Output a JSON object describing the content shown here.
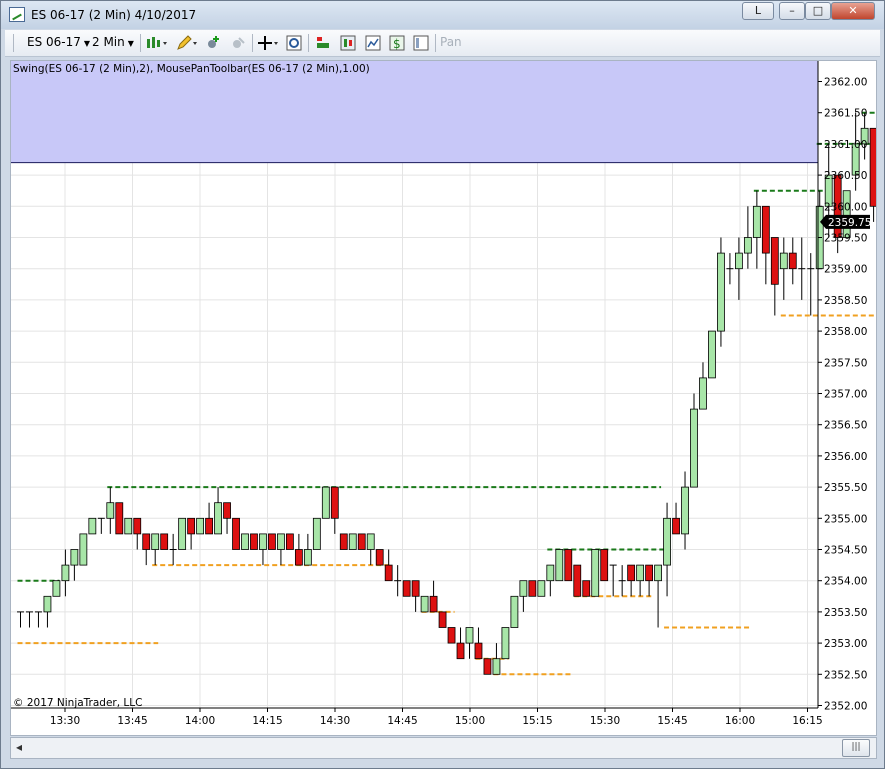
{
  "window": {
    "title": "ES 06-17 (2 Min)  4/10/2017",
    "btn_l": "L",
    "btn_min": "–",
    "btn_max": "□",
    "btn_close": "✕"
  },
  "toolbar": {
    "instrument": "ES 06-17",
    "interval": "2 Min",
    "pan_label": "Pan"
  },
  "chart": {
    "indicator_label": "Swing(ES 06-17 (2 Min),2), MousePanToolbar(ES 06-17 (2 Min),1.00)",
    "copyright": "© 2017 NinjaTrader, LLC",
    "last_price": "2359.75",
    "colors": {
      "up": "#a8e6a8",
      "down": "#dd1111",
      "swing_high": "#1a7a1a",
      "swing_low": "#f0a020",
      "zone": "#c8c8f8"
    }
  },
  "chart_data": {
    "type": "candlestick",
    "instrument": "ES 06-17",
    "interval": "2 Min",
    "date": "4/10/2017",
    "ylim": [
      2352.0,
      2362.0
    ],
    "y_ticks": [
      "2362.00",
      "2361.50",
      "2361.00",
      "2360.50",
      "2360.00",
      "2359.50",
      "2359.00",
      "2358.50",
      "2358.00",
      "2357.50",
      "2357.00",
      "2356.50",
      "2356.00",
      "2355.50",
      "2355.00",
      "2354.50",
      "2354.00",
      "2353.50",
      "2353.00",
      "2352.50",
      "2352.00"
    ],
    "x_ticks": [
      "13:30",
      "13:45",
      "14:00",
      "14:15",
      "14:30",
      "14:45",
      "15:00",
      "15:15",
      "15:30",
      "15:45",
      "16:00",
      "16:15"
    ],
    "candles": [
      [
        2353.5,
        2353.5,
        2353.25,
        2353.5
      ],
      [
        2353.5,
        2353.5,
        2353.25,
        2353.5
      ],
      [
        2353.5,
        2353.5,
        2353.25,
        2353.5
      ],
      [
        2353.5,
        2353.75,
        2353.25,
        2353.75
      ],
      [
        2353.75,
        2354.0,
        2353.75,
        2354.0
      ],
      [
        2354.0,
        2354.5,
        2353.75,
        2354.25
      ],
      [
        2354.25,
        2354.5,
        2354.0,
        2354.5
      ],
      [
        2354.25,
        2354.75,
        2354.25,
        2354.75
      ],
      [
        2354.75,
        2355.0,
        2354.75,
        2355.0
      ],
      [
        2355.0,
        2355.0,
        2354.75,
        2355.0
      ],
      [
        2355.0,
        2355.5,
        2354.75,
        2355.25
      ],
      [
        2355.25,
        2355.25,
        2354.75,
        2354.75
      ],
      [
        2354.75,
        2355.0,
        2354.75,
        2355.0
      ],
      [
        2355.0,
        2355.0,
        2354.5,
        2354.75
      ],
      [
        2354.75,
        2354.75,
        2354.25,
        2354.5
      ],
      [
        2354.5,
        2354.75,
        2354.25,
        2354.75
      ],
      [
        2354.75,
        2354.75,
        2354.5,
        2354.5
      ],
      [
        2354.5,
        2354.75,
        2354.25,
        2354.5
      ],
      [
        2354.5,
        2355.0,
        2354.5,
        2355.0
      ],
      [
        2355.0,
        2355.0,
        2354.5,
        2354.75
      ],
      [
        2354.75,
        2355.0,
        2354.75,
        2355.0
      ],
      [
        2355.0,
        2355.25,
        2354.75,
        2354.75
      ],
      [
        2354.75,
        2355.5,
        2354.75,
        2355.25
      ],
      [
        2355.25,
        2355.25,
        2354.75,
        2355.0
      ],
      [
        2355.0,
        2355.0,
        2354.5,
        2354.5
      ],
      [
        2354.5,
        2354.75,
        2354.5,
        2354.75
      ],
      [
        2354.75,
        2354.75,
        2354.5,
        2354.5
      ],
      [
        2354.5,
        2354.75,
        2354.25,
        2354.75
      ],
      [
        2354.75,
        2354.75,
        2354.5,
        2354.5
      ],
      [
        2354.5,
        2354.75,
        2354.25,
        2354.75
      ],
      [
        2354.75,
        2354.75,
        2354.5,
        2354.5
      ],
      [
        2354.5,
        2354.75,
        2354.25,
        2354.25
      ],
      [
        2354.25,
        2354.75,
        2354.25,
        2354.5
      ],
      [
        2354.5,
        2355.0,
        2354.5,
        2355.0
      ],
      [
        2355.0,
        2355.5,
        2355.0,
        2355.5
      ],
      [
        2355.5,
        2355.5,
        2354.75,
        2355.0
      ],
      [
        2354.75,
        2354.75,
        2354.5,
        2354.5
      ],
      [
        2354.5,
        2354.75,
        2354.5,
        2354.75
      ],
      [
        2354.75,
        2354.75,
        2354.5,
        2354.5
      ],
      [
        2354.5,
        2354.75,
        2354.25,
        2354.75
      ],
      [
        2354.5,
        2354.5,
        2354.25,
        2354.25
      ],
      [
        2354.25,
        2354.5,
        2354.0,
        2354.0
      ],
      [
        2354.0,
        2354.25,
        2353.75,
        2354.0
      ],
      [
        2354.0,
        2354.0,
        2353.75,
        2353.75
      ],
      [
        2354.0,
        2354.0,
        2353.5,
        2353.75
      ],
      [
        2353.5,
        2353.75,
        2353.5,
        2353.75
      ],
      [
        2353.75,
        2354.0,
        2353.5,
        2353.5
      ],
      [
        2353.5,
        2353.5,
        2353.25,
        2353.25
      ],
      [
        2353.25,
        2353.25,
        2353.0,
        2353.0
      ],
      [
        2353.0,
        2353.25,
        2352.75,
        2352.75
      ],
      [
        2353.0,
        2353.25,
        2352.75,
        2353.25
      ],
      [
        2353.0,
        2353.25,
        2352.75,
        2352.75
      ],
      [
        2352.75,
        2352.75,
        2352.5,
        2352.5
      ],
      [
        2352.5,
        2353.0,
        2352.5,
        2352.75
      ],
      [
        2352.75,
        2353.25,
        2352.75,
        2353.25
      ],
      [
        2353.25,
        2353.75,
        2353.25,
        2353.75
      ],
      [
        2353.75,
        2354.0,
        2353.5,
        2354.0
      ],
      [
        2354.0,
        2354.0,
        2353.75,
        2353.75
      ],
      [
        2353.75,
        2354.0,
        2353.75,
        2354.0
      ],
      [
        2354.0,
        2354.25,
        2353.75,
        2354.25
      ],
      [
        2354.0,
        2354.5,
        2354.0,
        2354.5
      ],
      [
        2354.5,
        2354.5,
        2354.0,
        2354.0
      ],
      [
        2354.25,
        2354.25,
        2353.75,
        2353.75
      ],
      [
        2354.0,
        2354.0,
        2353.75,
        2353.75
      ],
      [
        2353.75,
        2354.5,
        2353.75,
        2354.5
      ],
      [
        2354.5,
        2354.5,
        2354.0,
        2354.0
      ],
      [
        2354.25,
        2354.25,
        2353.75,
        2354.25
      ],
      [
        2354.0,
        2354.25,
        2353.75,
        2354.0
      ],
      [
        2354.25,
        2354.25,
        2353.75,
        2354.0
      ],
      [
        2354.0,
        2354.25,
        2353.75,
        2354.25
      ],
      [
        2354.25,
        2354.25,
        2353.75,
        2354.0
      ],
      [
        2354.0,
        2354.25,
        2353.25,
        2354.25
      ],
      [
        2354.25,
        2355.25,
        2353.75,
        2355.0
      ],
      [
        2355.0,
        2355.25,
        2354.75,
        2354.75
      ],
      [
        2354.75,
        2355.75,
        2354.5,
        2355.5
      ],
      [
        2355.5,
        2357.0,
        2355.5,
        2356.75
      ],
      [
        2356.75,
        2357.5,
        2356.75,
        2357.25
      ],
      [
        2357.25,
        2358.0,
        2357.25,
        2358.0
      ],
      [
        2358.0,
        2359.5,
        2357.75,
        2359.25
      ],
      [
        2359.0,
        2359.25,
        2358.75,
        2359.0
      ],
      [
        2359.0,
        2359.5,
        2358.5,
        2359.25
      ],
      [
        2359.25,
        2360.0,
        2359.0,
        2359.5
      ],
      [
        2359.5,
        2360.25,
        2359.0,
        2360.0
      ],
      [
        2360.0,
        2360.0,
        2358.75,
        2359.25
      ],
      [
        2359.5,
        2359.5,
        2358.25,
        2358.75
      ],
      [
        2359.0,
        2359.5,
        2358.5,
        2359.25
      ],
      [
        2359.25,
        2359.5,
        2358.75,
        2359.0
      ],
      [
        2359.0,
        2359.5,
        2358.5,
        2359.0
      ],
      [
        2359.0,
        2359.25,
        2358.25,
        2359.0
      ],
      [
        2359.0,
        2360.25,
        2359.0,
        2360.0
      ],
      [
        2360.0,
        2361.0,
        2359.5,
        2360.5
      ],
      [
        2360.5,
        2360.5,
        2359.25,
        2359.5
      ],
      [
        2359.5,
        2360.25,
        2359.5,
        2360.25
      ],
      [
        2360.5,
        2361.5,
        2360.25,
        2361.0
      ],
      [
        2361.0,
        2361.5,
        2360.75,
        2361.25
      ],
      [
        2361.25,
        2361.25,
        2359.75,
        2360.0
      ],
      [
        2360.0,
        2360.75,
        2360.0,
        2360.5
      ],
      [
        2360.0,
        2360.75,
        2359.75,
        2359.75
      ]
    ],
    "swing_highs": [
      {
        "price": 2354.0,
        "from": 0,
        "to": 4
      },
      {
        "price": 2355.5,
        "from": 10,
        "to": 71
      },
      {
        "price": 2354.5,
        "from": 59,
        "to": 72
      },
      {
        "price": 2360.25,
        "from": 82,
        "to": 89
      },
      {
        "price": 2361.0,
        "from": 89,
        "to": 95
      },
      {
        "price": 2361.5,
        "from": 94,
        "to": 98
      }
    ],
    "swing_lows": [
      {
        "price": 2353.0,
        "from": 0,
        "to": 15
      },
      {
        "price": 2354.25,
        "from": 15,
        "to": 41
      },
      {
        "price": 2353.5,
        "from": 45,
        "to": 48
      },
      {
        "price": 2352.75,
        "from": 51,
        "to": 54
      },
      {
        "price": 2352.5,
        "from": 53,
        "to": 61
      },
      {
        "price": 2353.75,
        "from": 62,
        "to": 70
      },
      {
        "price": 2353.25,
        "from": 72,
        "to": 81
      },
      {
        "price": 2358.25,
        "from": 85,
        "to": 97
      }
    ],
    "zone_low": 2360.7
  }
}
